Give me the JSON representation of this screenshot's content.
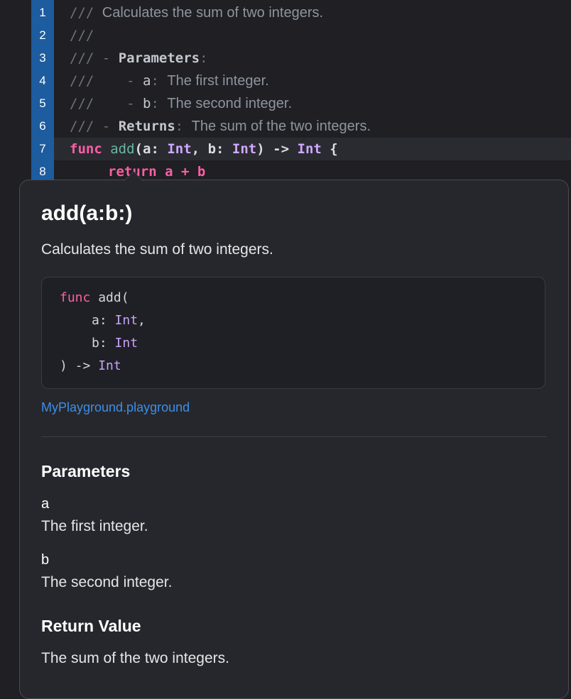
{
  "editor": {
    "line_numbers": [
      "1",
      "2",
      "3",
      "4",
      "5",
      "6",
      "7",
      "8"
    ],
    "doc": {
      "slash": "///",
      "summary": "Calculates the sum of two integers.",
      "dash": "-",
      "parameters_kw": "Parameters",
      "colon": ":",
      "param_a_name": "a",
      "param_a_desc": "The first integer.",
      "param_b_name": "b",
      "param_b_desc": "The second integer.",
      "returns_kw": "Returns",
      "returns_desc": "The sum of the two integers."
    },
    "signature": {
      "func_kw": "func",
      "name": "add",
      "open": "(",
      "a_label": "a:",
      "type_int": "Int",
      "comma": ",",
      "b_label": "b:",
      "close": ")",
      "arrow": "->",
      "brace": "{"
    },
    "body_line": "return a + b"
  },
  "popover": {
    "title": "add(a:b:)",
    "summary": "Calculates the sum of two integers.",
    "declaration": {
      "func_kw": "func",
      "name_open": "add(",
      "a_label": "a:",
      "b_label": "b:",
      "type_int": "Int",
      "comma": ",",
      "close_arrow": ") ->"
    },
    "source_link": "MyPlayground.playground",
    "parameters_heading": "Parameters",
    "params": [
      {
        "name": "a",
        "desc": "The first integer."
      },
      {
        "name": "b",
        "desc": "The second integer."
      }
    ],
    "return_heading": "Return Value",
    "return_desc": "The sum of the two integers."
  },
  "colors": {
    "keyword": "#fc5fa3",
    "function": "#67b7a4",
    "type": "#d0a8ff",
    "link": "#3d8fe8",
    "gutter_highlight": "#1d5c9e"
  }
}
